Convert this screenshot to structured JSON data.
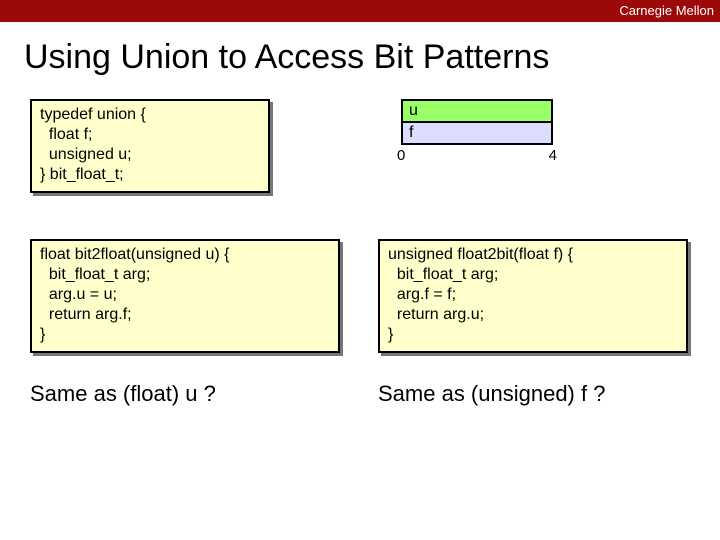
{
  "header": {
    "brand": "Carnegie Mellon"
  },
  "title": "Using Union to Access Bit Patterns",
  "code": {
    "typedef": "typedef union {\n  float f;\n  unsigned u;\n} bit_float_t;",
    "bit2float": "float bit2float(unsigned u) {\n  bit_float_t arg;\n  arg.u = u;\n  return arg.f;\n}",
    "float2bit": "unsigned float2bit(float f) {\n  bit_float_t arg;\n  arg.f = f;\n  return arg.u;\n}"
  },
  "diagram": {
    "row_u": "u",
    "row_f": "f",
    "tick0": "0",
    "tick4": "4"
  },
  "question": {
    "left": "Same as (float) u ?",
    "right": "Same as (unsigned) f ?"
  }
}
